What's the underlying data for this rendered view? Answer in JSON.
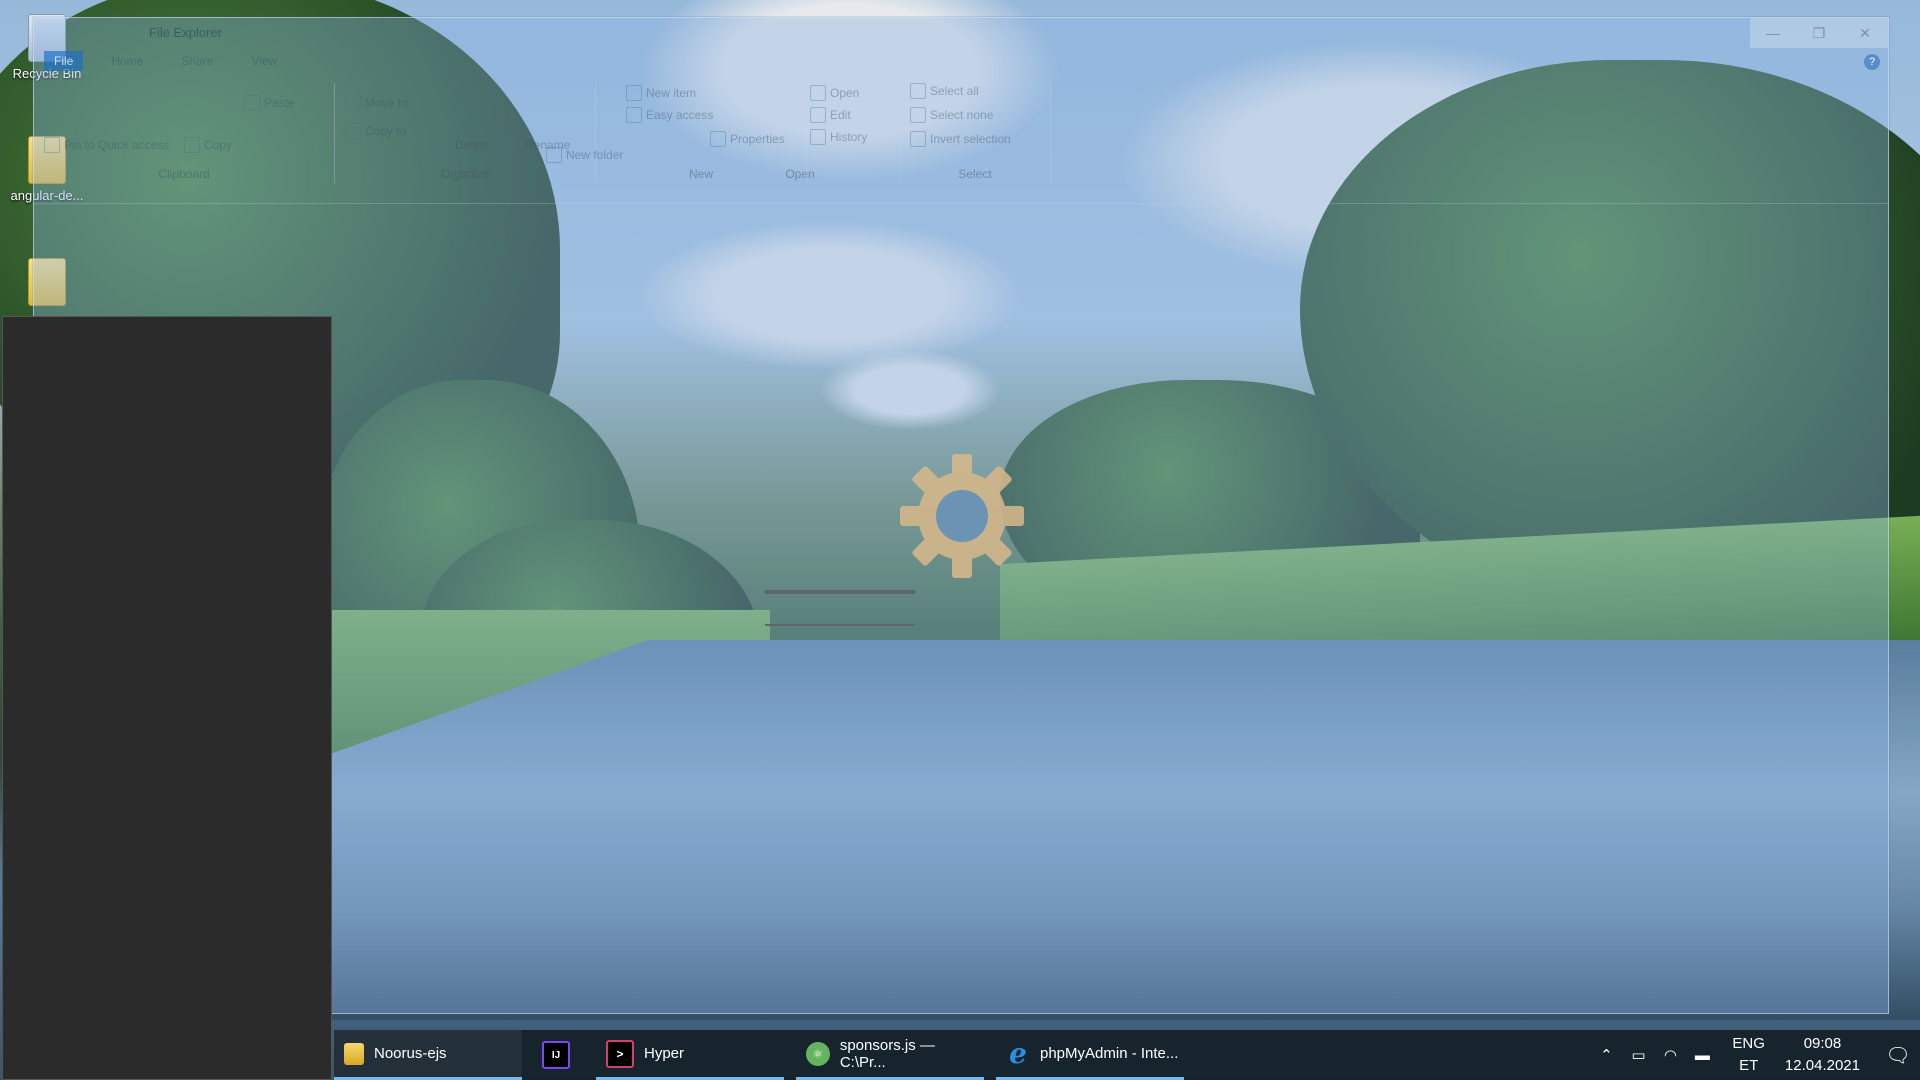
{
  "desktop": {
    "icons": [
      {
        "label": "Recycle Bin"
      },
      {
        "label": "angular-de..."
      },
      {
        "label": ""
      }
    ]
  },
  "explorer": {
    "title": "File Explorer",
    "tabs": [
      "File",
      "Home",
      "Share",
      "View"
    ],
    "window_buttons": {
      "minimize": "—",
      "maximize": "❐",
      "close": "✕"
    },
    "help": "?",
    "ribbon": {
      "clipboard": {
        "caption": "Clipboard",
        "items": [
          "Pin to Quick access",
          "Copy",
          "Paste"
        ]
      },
      "organize": {
        "caption": "Organize",
        "items": [
          "Move to",
          "Copy to",
          "Delete",
          "Rename"
        ]
      },
      "new": {
        "caption": "New",
        "items": [
          "New item",
          "Easy access",
          "New folder"
        ]
      },
      "open": {
        "caption": "Open",
        "items": [
          "Properties",
          "Open",
          "Edit",
          "History"
        ]
      },
      "select": {
        "caption": "Select",
        "items": [
          "Select all",
          "Select none",
          "Invert selection"
        ]
      }
    }
  },
  "taskbar": {
    "items": [
      {
        "label": "Noorus-ejs",
        "icon": "folder-icon"
      },
      {
        "label": "",
        "icon": "intellij-icon"
      },
      {
        "label": "Hyper",
        "icon": "hyper-terminal-icon"
      },
      {
        "label": "sponsors.js — C:\\Pr...",
        "icon": "atom-icon"
      },
      {
        "label": "phpMyAdmin - Inte...",
        "icon": "internet-explorer-icon"
      }
    ],
    "tray": {
      "language_line1": "ENG",
      "language_line2": "ET",
      "time": "09:08",
      "date": "12.04.2021"
    }
  },
  "colors": {
    "accent": "#76b9ed",
    "explorer_tint": "#8cb4e1",
    "gear": "#d9b98a"
  }
}
